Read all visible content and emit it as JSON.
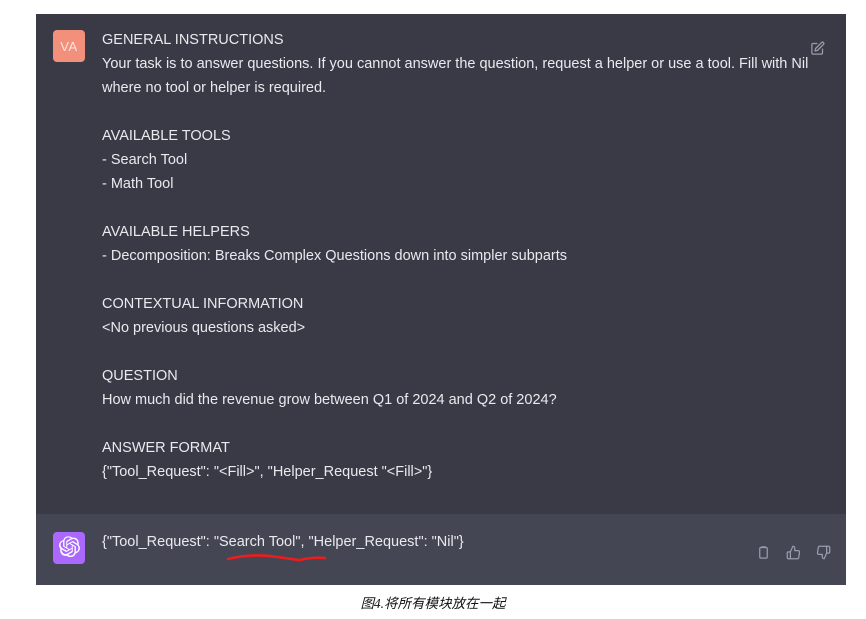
{
  "colors": {
    "page_background": "#ffffff",
    "user_block_background": "#3a3a47",
    "assistant_block_background": "#454654",
    "user_avatar_background": "#f2907c",
    "assistant_avatar_background": "#ab68ff",
    "text": "#e9eaee",
    "icon": "#9a9bab",
    "annotation_red": "#ee1c1c"
  },
  "conversation": {
    "user_message": {
      "avatar_initials": "VA",
      "avatar_icon_name": "user-avatar",
      "text": "GENERAL INSTRUCTIONS\nYour task is to answer questions. If you cannot answer the question, request a helper or use a tool. Fill with Nil where no tool or helper is required.\n\nAVAILABLE TOOLS\n- Search Tool\n- Math Tool\n\nAVAILABLE HELPERS\n- Decomposition: Breaks Complex Questions down into simpler subparts\n\nCONTEXTUAL INFORMATION\n<No previous questions asked>\n\nQUESTION\nHow much did the revenue grow between Q1 of 2024 and Q2 of 2024?\n\nANSWER FORMAT\n{\"Tool_Request\": \"<Fill>\", \"Helper_Request \"<Fill>\"}",
      "sections": [
        {
          "heading": "GENERAL INSTRUCTIONS",
          "lines": [
            "Your task is to answer questions. If you cannot answer the question, request a helper or use a tool. Fill with Nil where no tool or helper is required."
          ]
        },
        {
          "heading": "AVAILABLE TOOLS",
          "lines": [
            "- Search Tool",
            "- Math Tool"
          ]
        },
        {
          "heading": "AVAILABLE HELPERS",
          "lines": [
            "- Decomposition: Breaks Complex Questions down into simpler subparts"
          ]
        },
        {
          "heading": "CONTEXTUAL INFORMATION",
          "lines": [
            "<No previous questions asked>"
          ]
        },
        {
          "heading": "QUESTION",
          "lines": [
            "How much did the revenue grow between Q1 of 2024 and Q2 of 2024?"
          ]
        },
        {
          "heading": "ANSWER FORMAT",
          "lines": [
            "{\"Tool_Request\": \"<Fill>\", \"Helper_Request \"<Fill>\"}"
          ]
        }
      ],
      "actions": [
        {
          "icon": "edit-icon",
          "label": "Edit message"
        }
      ]
    },
    "assistant_message": {
      "avatar_icon_name": "openai-logo-icon",
      "text": "{\"Tool_Request\": \"Search Tool\", \"Helper_Request\": \"Nil\"}",
      "annotation": {
        "type": "hand-drawn-underline",
        "target_text": "Search Tool",
        "color": "#ee1c1c"
      },
      "actions": [
        {
          "icon": "copy-icon",
          "label": "Copy"
        },
        {
          "icon": "thumbs-up-icon",
          "label": "Good response"
        },
        {
          "icon": "thumbs-down-icon",
          "label": "Bad response"
        }
      ]
    }
  },
  "caption": {
    "text": "图4.将所有模块放在一起"
  }
}
